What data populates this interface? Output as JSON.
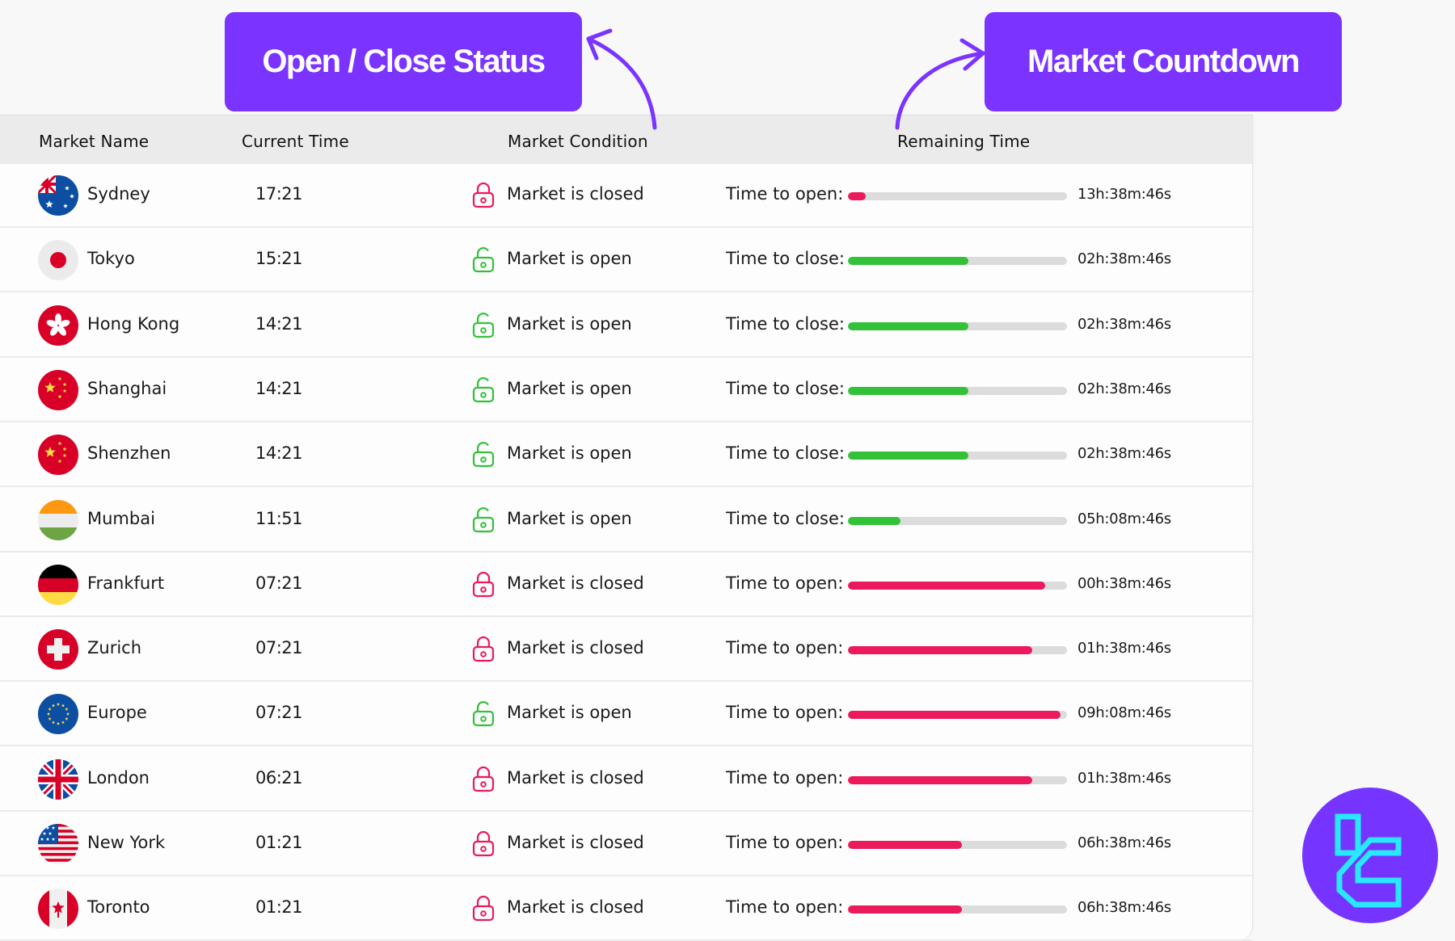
{
  "callouts": {
    "status": "Open / Close Status",
    "countdown": "Market Countdown"
  },
  "colors": {
    "accent": "#7b34ff",
    "open": "#33c13a",
    "closed": "#ea1a5c",
    "logo_line": "#27e8ff"
  },
  "table": {
    "headers": {
      "market_name": "Market Name",
      "current_time": "Current Time",
      "market_condition": "Market Condition",
      "remaining_time": "Remaining Time"
    },
    "rows": [
      {
        "name": "Sydney",
        "flag": "australia-flag",
        "time": "17:21",
        "state": "closed",
        "status": "Market is closed",
        "label": "Time to open:",
        "progress": 0.08,
        "bar": "closed",
        "remaining": "13h:38m:46s"
      },
      {
        "name": "Tokyo",
        "flag": "japan-flag",
        "time": "15:21",
        "state": "open",
        "status": "Market is open",
        "label": "Time to close:",
        "progress": 0.55,
        "bar": "open",
        "remaining": "02h:38m:46s"
      },
      {
        "name": "Hong Kong",
        "flag": "hong-kong-flag",
        "time": "14:21",
        "state": "open",
        "status": "Market is open",
        "label": "Time to close:",
        "progress": 0.55,
        "bar": "open",
        "remaining": "02h:38m:46s"
      },
      {
        "name": "Shanghai",
        "flag": "china-flag",
        "time": "14:21",
        "state": "open",
        "status": "Market is open",
        "label": "Time to close:",
        "progress": 0.55,
        "bar": "open",
        "remaining": "02h:38m:46s"
      },
      {
        "name": "Shenzhen",
        "flag": "china-flag",
        "time": "14:21",
        "state": "open",
        "status": "Market is open",
        "label": "Time to close:",
        "progress": 0.55,
        "bar": "open",
        "remaining": "02h:38m:46s"
      },
      {
        "name": "Mumbai",
        "flag": "india-flag",
        "time": "11:51",
        "state": "open",
        "status": "Market is open",
        "label": "Time to close:",
        "progress": 0.24,
        "bar": "open",
        "remaining": "05h:08m:46s"
      },
      {
        "name": "Frankfurt",
        "flag": "germany-flag",
        "time": "07:21",
        "state": "closed",
        "status": "Market is closed",
        "label": "Time to open:",
        "progress": 0.9,
        "bar": "closed",
        "remaining": "00h:38m:46s"
      },
      {
        "name": "Zurich",
        "flag": "switzerland-flag",
        "time": "07:21",
        "state": "closed",
        "status": "Market is closed",
        "label": "Time to open:",
        "progress": 0.84,
        "bar": "closed",
        "remaining": "01h:38m:46s"
      },
      {
        "name": "Europe",
        "flag": "eu-flag",
        "time": "07:21",
        "state": "open",
        "status": "Market is open",
        "label": "Time to open:",
        "progress": 0.97,
        "bar": "closed",
        "remaining": "09h:08m:46s"
      },
      {
        "name": "London",
        "flag": "uk-flag",
        "time": "06:21",
        "state": "closed",
        "status": "Market is closed",
        "label": "Time to open:",
        "progress": 0.84,
        "bar": "closed",
        "remaining": "01h:38m:46s"
      },
      {
        "name": "New York",
        "flag": "usa-flag",
        "time": "01:21",
        "state": "closed",
        "status": "Market is closed",
        "label": "Time to open:",
        "progress": 0.52,
        "bar": "closed",
        "remaining": "06h:38m:46s"
      },
      {
        "name": "Toronto",
        "flag": "canada-flag",
        "time": "01:21",
        "state": "closed",
        "status": "Market is closed",
        "label": "Time to open:",
        "progress": 0.52,
        "bar": "closed",
        "remaining": "06h:38m:46s"
      }
    ]
  }
}
